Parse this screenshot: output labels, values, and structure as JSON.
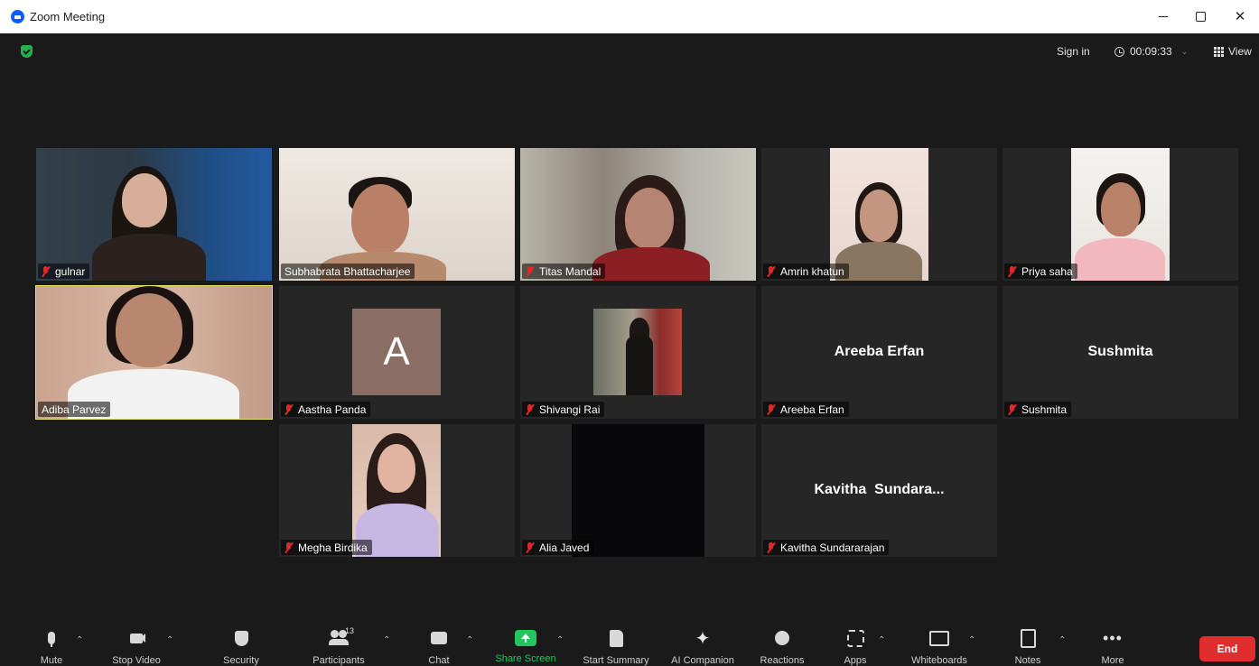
{
  "window": {
    "title": "Zoom Meeting"
  },
  "topbar": {
    "sign_in": "Sign in",
    "timer": "00:09:33",
    "view": "View"
  },
  "participants": {
    "gulnar": "gulnar",
    "subhabrata": "Subhabrata Bhattacharjee",
    "titas": "Titas Mandal",
    "amrin": "Amrin khatun",
    "priya": "Priya saha",
    "adiba": "Adiba Parvez",
    "aastha": "Aastha Panda",
    "aastha_initial": "A",
    "shivangi": "Shivangi Rai",
    "areeba": "Areeba Erfan",
    "areeba_center": "Areeba Erfan",
    "sushmita": "Sushmita",
    "sushmita_center": "Sushmita",
    "megha": "Megha Birdika",
    "alia": "Alia Javed",
    "kavitha": "Kavitha Sundararajan",
    "kavitha_center": "Kavitha  Sundara..."
  },
  "toolbar": {
    "mute": "Mute",
    "stop_video": "Stop Video",
    "security": "Security",
    "participants": "Participants",
    "participants_count": "13",
    "chat": "Chat",
    "share_screen": "Share Screen",
    "start_summary": "Start Summary",
    "ai_companion": "AI Companion",
    "reactions": "Reactions",
    "apps": "Apps",
    "whiteboards": "Whiteboards",
    "notes": "Notes",
    "more": "More",
    "end": "End"
  },
  "colors": {
    "background": "#1a1a1a",
    "tile": "#262626",
    "active_speaker": "#e6e65a",
    "share_green": "#22c55e",
    "end_red": "#e02d2d",
    "mic_off_red": "#e02828"
  },
  "icons": {
    "zoom_logo": "zoom-logo-icon",
    "shield": "shield-icon",
    "clock": "clock-icon",
    "view_grid": "grid-icon",
    "mic_off": "mic-off-icon"
  }
}
